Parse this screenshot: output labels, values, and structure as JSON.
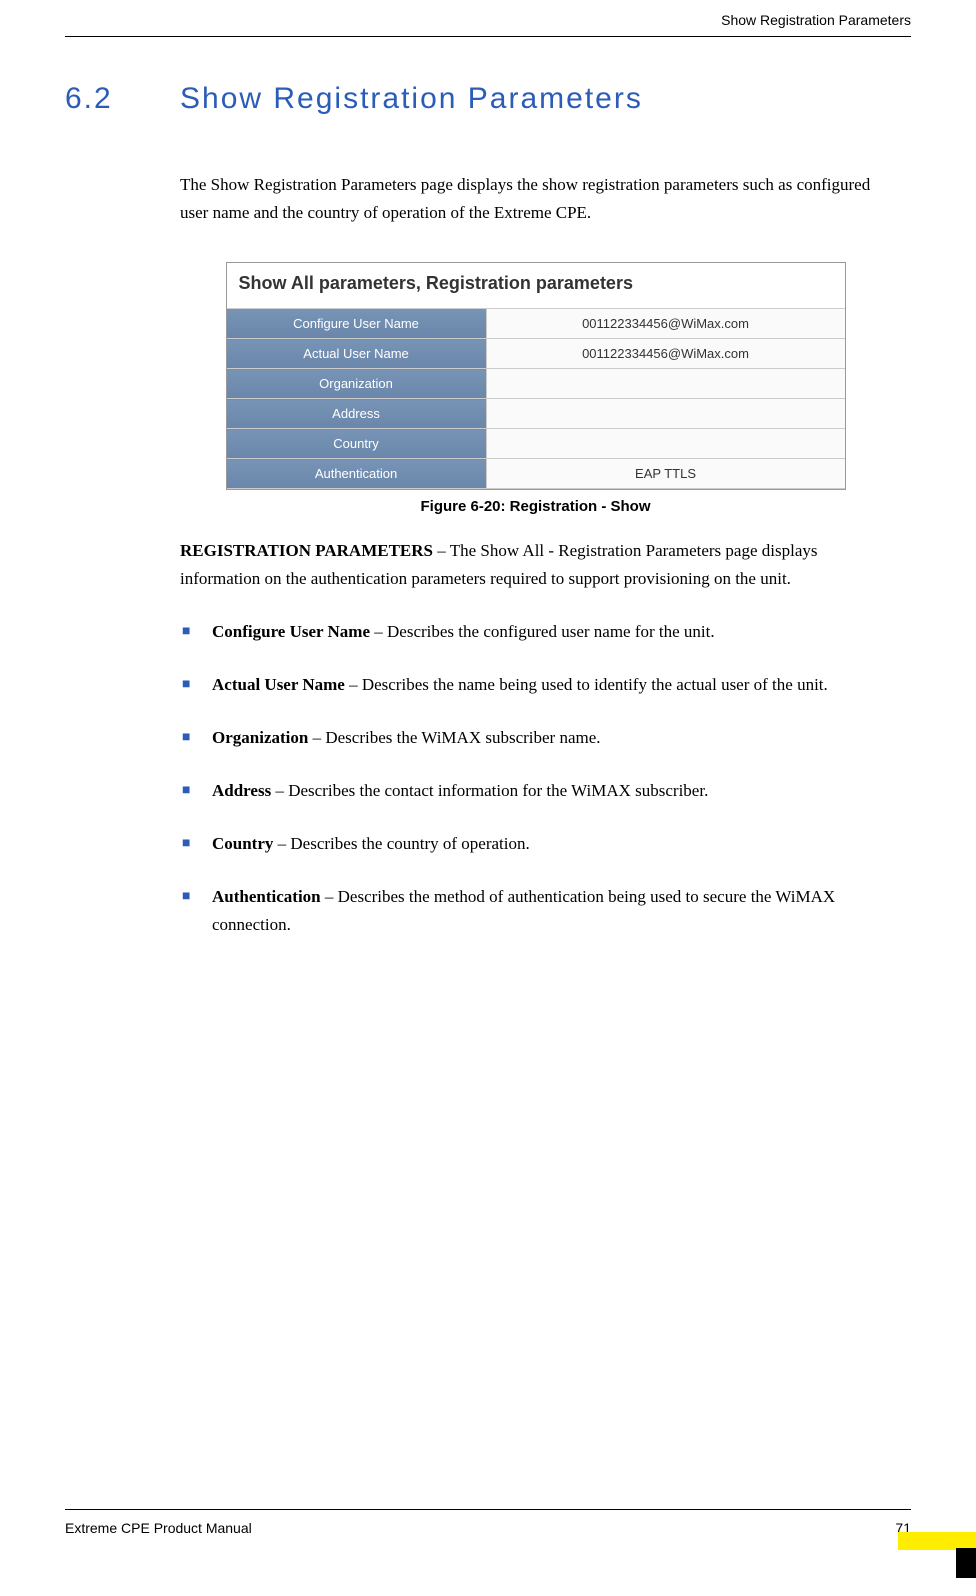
{
  "header": {
    "running_title": "Show Registration Parameters"
  },
  "section": {
    "number": "6.2",
    "title": "Show Registration Parameters"
  },
  "intro": "The Show Registration Parameters page displays the show registration parameters such as configured user name and the country of operation of the Extreme CPE.",
  "screenshot": {
    "title": "Show All parameters, Registration parameters",
    "rows": [
      {
        "label": "Configure User Name",
        "value": "001122334456@WiMax.com"
      },
      {
        "label": "Actual User Name",
        "value": "001122334456@WiMax.com"
      },
      {
        "label": "Organization",
        "value": ""
      },
      {
        "label": "Address",
        "value": ""
      },
      {
        "label": "Country",
        "value": ""
      },
      {
        "label": "Authentication",
        "value": "EAP TTLS"
      }
    ]
  },
  "figure_caption": "Figure 6-20: Registration - Show",
  "description": {
    "lead": "REGISTRATION PARAMETERS",
    "text": " – The Show All - Registration Parameters page displays information on the authentication parameters required to support provisioning on the unit."
  },
  "bullets": [
    {
      "term": "Configure User Name",
      "text": " – Describes the configured user name for the unit."
    },
    {
      "term": "Actual User Name",
      "text": " – Describes the name being used to identify the actual user of the unit."
    },
    {
      "term": "Organization",
      "text": " – Describes the WiMAX subscriber name."
    },
    {
      "term": "Address",
      "text": " – Describes the contact information for the WiMAX subscriber."
    },
    {
      "term": "Country",
      "text": " – Describes the country of operation."
    },
    {
      "term": "Authentication",
      "text": " – Describes the method of authentication being used to secure the WiMAX connection."
    }
  ],
  "footer": {
    "manual_name": "Extreme CPE Product Manual",
    "page_number": "71"
  }
}
